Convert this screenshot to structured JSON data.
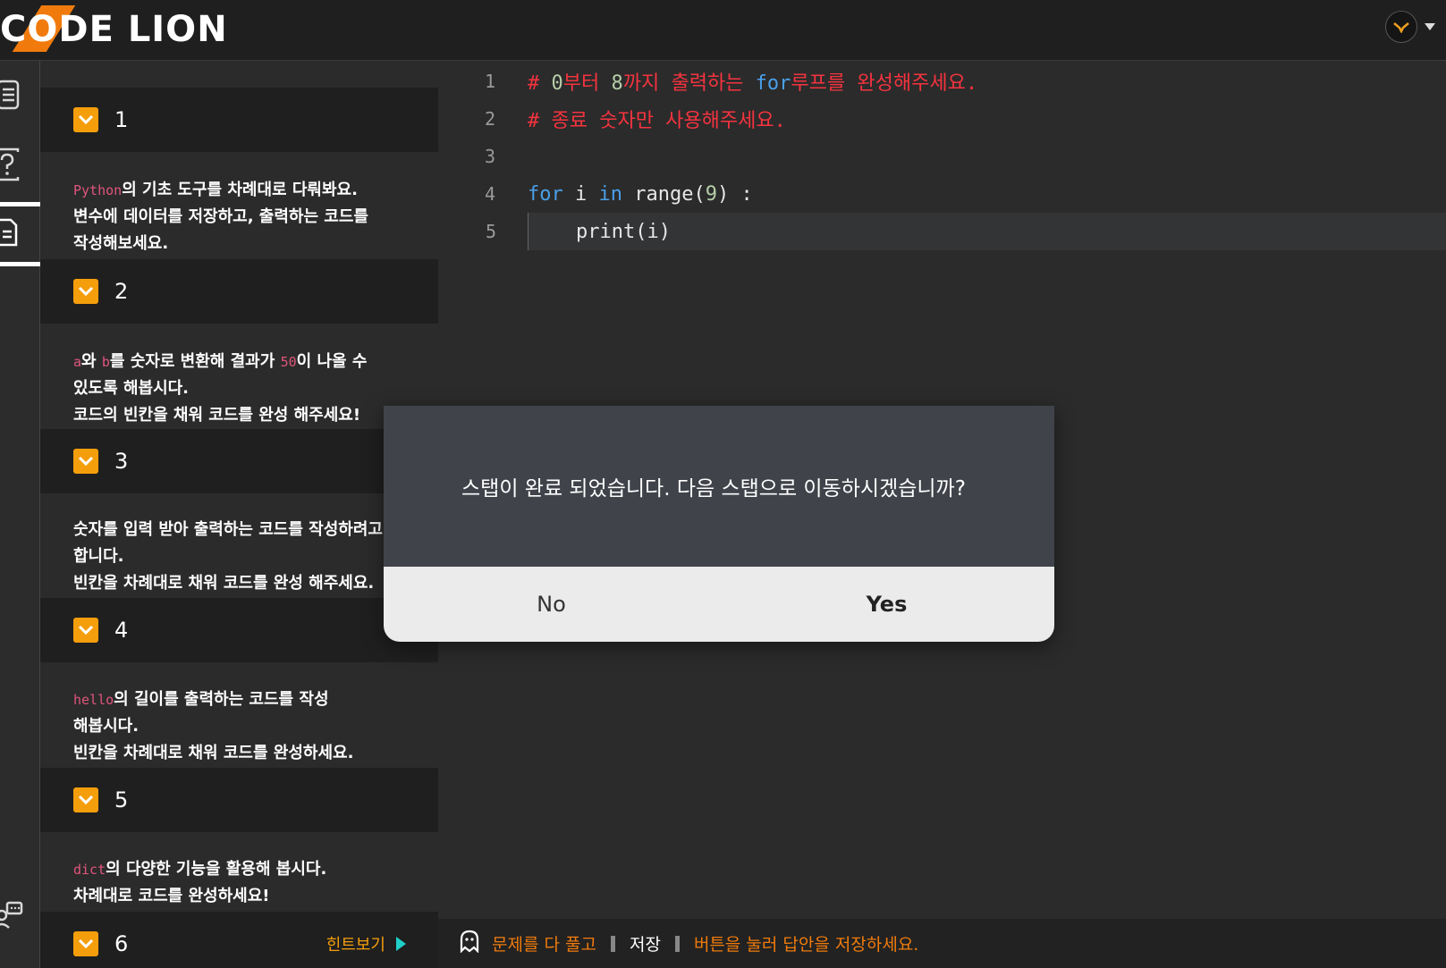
{
  "header": {
    "logo_text": "CODE LION",
    "avatar_icon": "lion-avatar-icon"
  },
  "rail": {
    "items": [
      {
        "icon": "document-list-icon"
      },
      {
        "icon": "question-icon"
      },
      {
        "icon": "file-text-icon"
      },
      {
        "icon": "community-chat-icon"
      }
    ]
  },
  "steps": [
    {
      "number": "1",
      "desc_code": "Python",
      "desc_lines": [
        "의 기초 도구를 차례대로 다뤄봐요.",
        "변수에 데이터를 저장하고, 출력하는 코드를",
        "작성해보세요."
      ]
    },
    {
      "number": "2",
      "desc_parts": {
        "a": "a",
        "t1": "와 ",
        "b": "b",
        "t2": "를 숫자로 변환해 결과가 ",
        "n": "50",
        "t3": "이 나올 수"
      },
      "desc_lines": [
        "있도록 해봅시다.",
        "코드의 빈칸을 채워 코드를 완성 해주세요!"
      ]
    },
    {
      "number": "3",
      "desc_lines": [
        "숫자를 입력 받아 출력하는 코드를 작성하려고",
        "합니다.",
        "빈칸을 차례대로 채워 코드를 완성 해주세요."
      ]
    },
    {
      "number": "4",
      "desc_code": "hello",
      "desc_lines": [
        "의 길이를 출력하는 코드를 작성",
        "해봅시다.",
        "빈칸을 차례대로 채워 코드를 완성하세요."
      ]
    },
    {
      "number": "5",
      "desc_code": "dict",
      "desc_lines": [
        "의 다양한 기능을 활용해 봅시다.",
        "차례대로 코드를 완성하세요!"
      ]
    },
    {
      "number": "6",
      "hint_label": "힌트보기"
    }
  ],
  "editor": {
    "line_numbers": [
      "1",
      "2",
      "3",
      "4",
      "5"
    ],
    "line1": {
      "hash": "# ",
      "n0": "0",
      "t1": "부터 ",
      "n8": "8",
      "t2": "까지 출력하는 ",
      "kw": "for",
      "t3": "루프를 완성해주세요."
    },
    "line2": "# 종료 숫자만 사용해주세요.",
    "line4": {
      "kw_for": "for",
      "v": " i ",
      "kw_in": "in",
      "fn": " range(",
      "num": "9",
      "rest": ") :"
    },
    "line5": "    print(i)"
  },
  "footer": {
    "part1": "문제를 다 풀고",
    "save": "저장",
    "part2": "버튼을 눌러 답안을 저장하세요."
  },
  "modal": {
    "message": "스탭이 완료 되었습니다. 다음 스탭으로 이동하시겠습니까?",
    "no_label": "No",
    "yes_label": "Yes"
  },
  "colors": {
    "accent_orange": "#f07b0c",
    "check_orange": "#f59e0b",
    "comment_red": "#f5333f",
    "keyword_blue": "#4a9fe8"
  }
}
